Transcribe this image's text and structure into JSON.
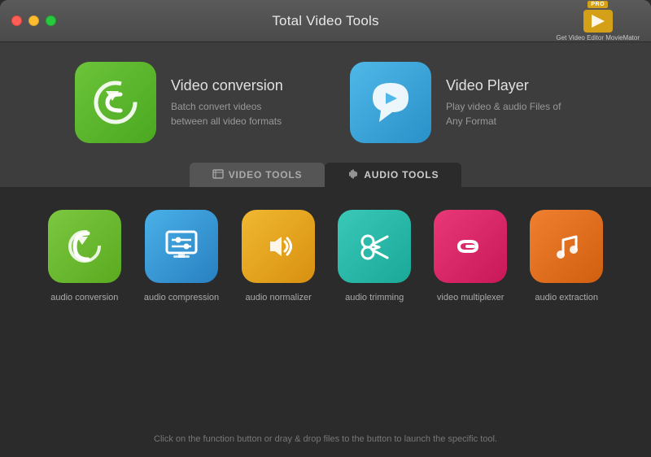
{
  "window": {
    "title": "Total Video Tools"
  },
  "trafficLights": {
    "red": "close",
    "yellow": "minimize",
    "green": "maximize"
  },
  "logo": {
    "badge": "PRO",
    "text": "Get Video Editor MovieMator"
  },
  "topCards": [
    {
      "id": "video-conversion",
      "iconColor": "green",
      "title": "Video conversion",
      "description": "Batch convert videos between all video formats"
    },
    {
      "id": "video-player",
      "iconColor": "blue",
      "title": "Video Player",
      "description": "Play video & audio Files of Any Format"
    }
  ],
  "tabs": [
    {
      "id": "video-tools",
      "label": "VIDEO TOOLS",
      "active": false
    },
    {
      "id": "audio-tools",
      "label": "AUDIO TOOLS",
      "active": true
    }
  ],
  "tools": [
    {
      "id": "audio-conversion",
      "label": "audio conversion",
      "colorClass": "tool-green"
    },
    {
      "id": "audio-compression",
      "label": "audio compression",
      "colorClass": "tool-blue"
    },
    {
      "id": "audio-normalizer",
      "label": "audio normalizer",
      "colorClass": "tool-yellow"
    },
    {
      "id": "audio-trimming",
      "label": "audio trimming",
      "colorClass": "tool-teal"
    },
    {
      "id": "video-multiplexer",
      "label": "video multiplexer",
      "colorClass": "tool-pink"
    },
    {
      "id": "audio-extraction",
      "label": "audio extraction",
      "colorClass": "tool-orange"
    }
  ],
  "footer": {
    "text": "Click on the function button or dray & drop files to the button to launch the specific tool."
  }
}
